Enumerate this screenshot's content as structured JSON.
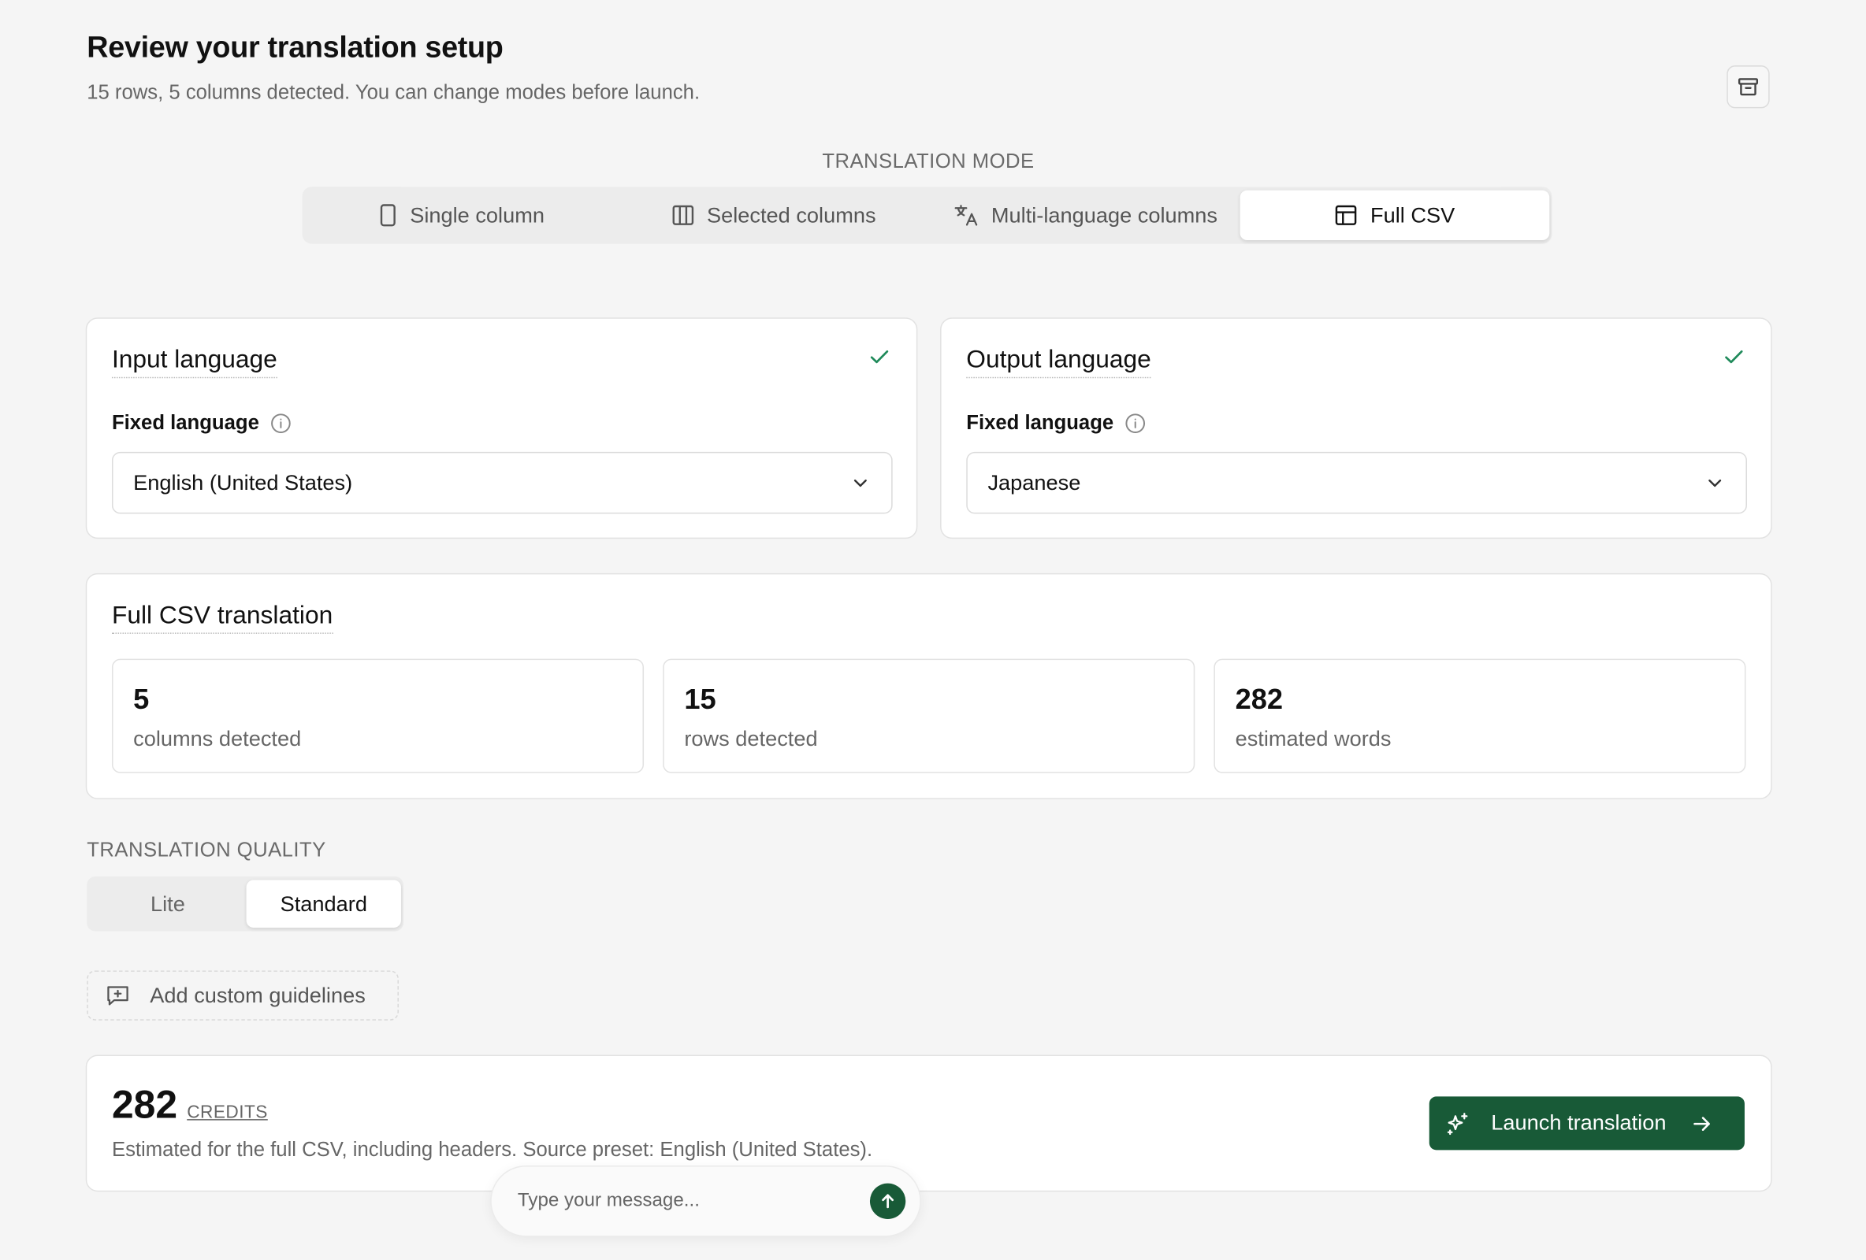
{
  "header": {
    "title": "Review your translation setup",
    "subtitle": "15 rows, 5 columns detected. You can change modes before launch.",
    "archive_icon": "archive-icon"
  },
  "translation_mode": {
    "label": "TRANSLATION MODE",
    "options": [
      {
        "label": "Single column",
        "icon": "phone-rectangle-icon",
        "active": false
      },
      {
        "label": "Selected columns",
        "icon": "columns-icon",
        "active": false
      },
      {
        "label": "Multi-language columns",
        "icon": "translate-icon",
        "active": false
      },
      {
        "label": "Full CSV",
        "icon": "table-icon",
        "active": true
      }
    ]
  },
  "input_language": {
    "title": "Input language",
    "field_label": "Fixed language",
    "value": "English (United States)",
    "verified": true
  },
  "output_language": {
    "title": "Output language",
    "field_label": "Fixed language",
    "value": "Japanese",
    "verified": true
  },
  "full_csv": {
    "title": "Full CSV translation",
    "stats": [
      {
        "value": "5",
        "label": "columns detected"
      },
      {
        "value": "15",
        "label": "rows detected"
      },
      {
        "value": "282",
        "label": "estimated words"
      }
    ]
  },
  "translation_quality": {
    "label": "TRANSLATION QUALITY",
    "options": [
      {
        "label": "Lite",
        "active": false
      },
      {
        "label": "Standard",
        "active": true
      }
    ]
  },
  "guidelines": {
    "label": "Add custom guidelines"
  },
  "summary": {
    "credits": "282",
    "credits_unit": "CREDITS",
    "description": "Estimated for the full CSV, including headers. Source preset: English (United States).",
    "launch_label": "Launch translation"
  },
  "chat": {
    "placeholder": "Type your message..."
  },
  "colors": {
    "accent": "#185a37",
    "check": "#1f8a5a",
    "background": "#f5f5f5"
  }
}
